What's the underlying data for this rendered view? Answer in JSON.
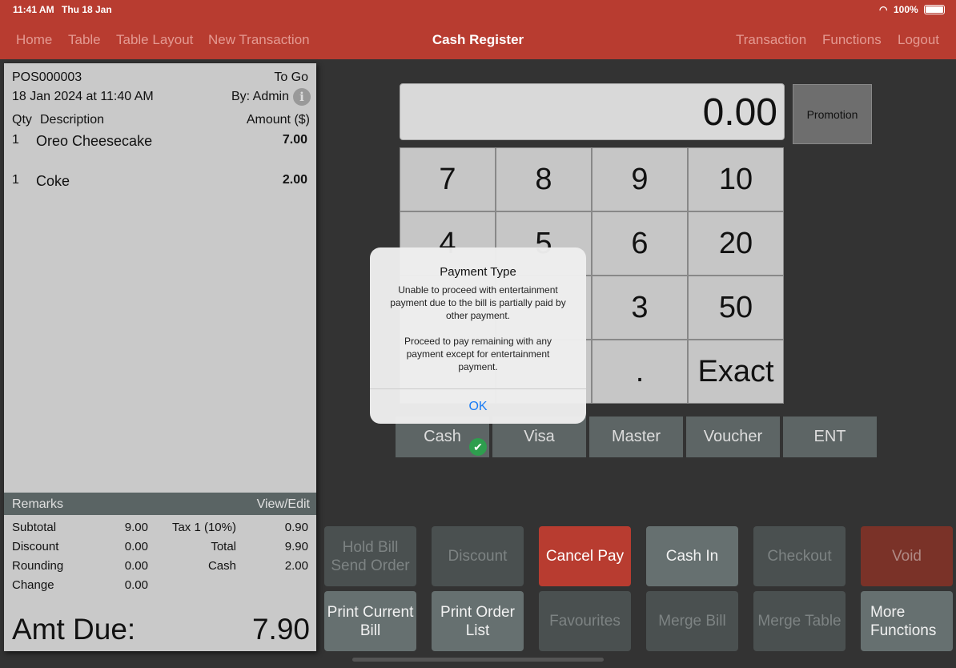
{
  "status": {
    "time": "11:41 AM",
    "date": "Thu 18 Jan",
    "battery": "100%"
  },
  "nav": {
    "left": [
      "Home",
      "Table",
      "Table Layout",
      "New Transaction"
    ],
    "title": "Cash Register",
    "right": [
      "Transaction",
      "Functions",
      "Logout"
    ]
  },
  "receipt": {
    "id": "POS000003",
    "type": "To Go",
    "datetime": "18 Jan 2024 at 11:40 AM",
    "by": "By: Admin",
    "headers": {
      "qty": "Qty",
      "desc": "Description",
      "amount": "Amount ($)"
    },
    "items": [
      {
        "qty": "1",
        "desc": "Oreo Cheesecake",
        "amount": "7.00"
      },
      {
        "qty": "1",
        "desc": "Coke",
        "amount": "2.00"
      }
    ],
    "remarks": "Remarks",
    "view_edit": "View/Edit",
    "summary": {
      "subtotal_label": "Subtotal",
      "subtotal": "9.00",
      "discount_label": "Discount",
      "discount": "0.00",
      "rounding_label": "Rounding",
      "rounding": "0.00",
      "change_label": "Change",
      "change": "0.00",
      "tax_label": "Tax 1 (10%)",
      "tax": "0.90",
      "total_label": "Total",
      "total": "9.90",
      "cash_label": "Cash",
      "cash": "2.00"
    },
    "amt_due_label": "Amt Due:",
    "amt_due": "7.90"
  },
  "display": "0.00",
  "promotion": "Promotion",
  "keypad": [
    "7",
    "8",
    "9",
    "10",
    "4",
    "5",
    "6",
    "20",
    "",
    "",
    "3",
    "50",
    "",
    "",
    ".",
    "Exact"
  ],
  "payments": [
    "Cash",
    "Visa",
    "Master",
    "Voucher",
    "ENT"
  ],
  "functions": [
    {
      "label": "Hold Bill Send Order",
      "state": "disabled"
    },
    {
      "label": "Discount",
      "state": "disabled"
    },
    {
      "label": "Cancel Pay",
      "state": "cancel"
    },
    {
      "label": "Cash In",
      "state": "enabled"
    },
    {
      "label": "Checkout",
      "state": "disabled"
    },
    {
      "label": "Void",
      "state": "void"
    },
    {
      "label": "Print Current Bill",
      "state": "enabled"
    },
    {
      "label": "Print Order List",
      "state": "enabled"
    },
    {
      "label": "Favourites",
      "state": "disabled"
    },
    {
      "label": "Merge Bill",
      "state": "disabled"
    },
    {
      "label": "Merge Table",
      "state": "disabled"
    },
    {
      "label": "More Functions",
      "state": "enabled"
    }
  ],
  "dialog": {
    "title": "Payment Type",
    "message1": "Unable to proceed with entertainment payment due to the bill is partially paid by other payment.",
    "message2": "Proceed to pay remaining with any payment except for entertainment payment.",
    "ok": "OK"
  },
  "colors": {
    "brand": "#b83c30",
    "selected_check": "#2e9e4e",
    "link": "#1a7cf5"
  }
}
